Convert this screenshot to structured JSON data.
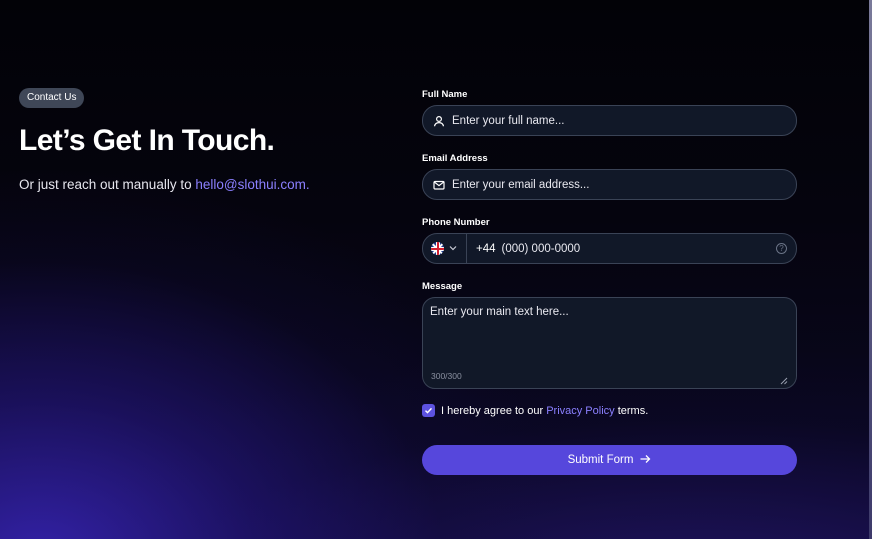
{
  "hero": {
    "badge": "Contact Us",
    "headline": "Let’s Get In Touch.",
    "subline_prefix": "Or just reach out manually to ",
    "email": "hello@slothui.com."
  },
  "form": {
    "full_name": {
      "label": "Full Name",
      "placeholder": "Enter your full name...",
      "icon": "user-icon"
    },
    "email": {
      "label": "Email Address",
      "placeholder": "Enter your email address...",
      "icon": "mail-icon"
    },
    "phone": {
      "label": "Phone Number",
      "country_code": "+44",
      "placeholder": "(000) 000-0000",
      "country_flag": "uk-flag-icon"
    },
    "message": {
      "label": "Message",
      "placeholder": "Enter your main text here...",
      "counter": "300/300"
    },
    "agree": {
      "prefix": "I hereby agree to our ",
      "link": "Privacy Policy",
      "suffix": " terms.",
      "checked": true
    },
    "submit_label": "Submit Form"
  },
  "colors": {
    "accent": "#5647dc",
    "link": "#8b80ff",
    "field_bg": "#111828",
    "field_border": "#3a4356"
  }
}
